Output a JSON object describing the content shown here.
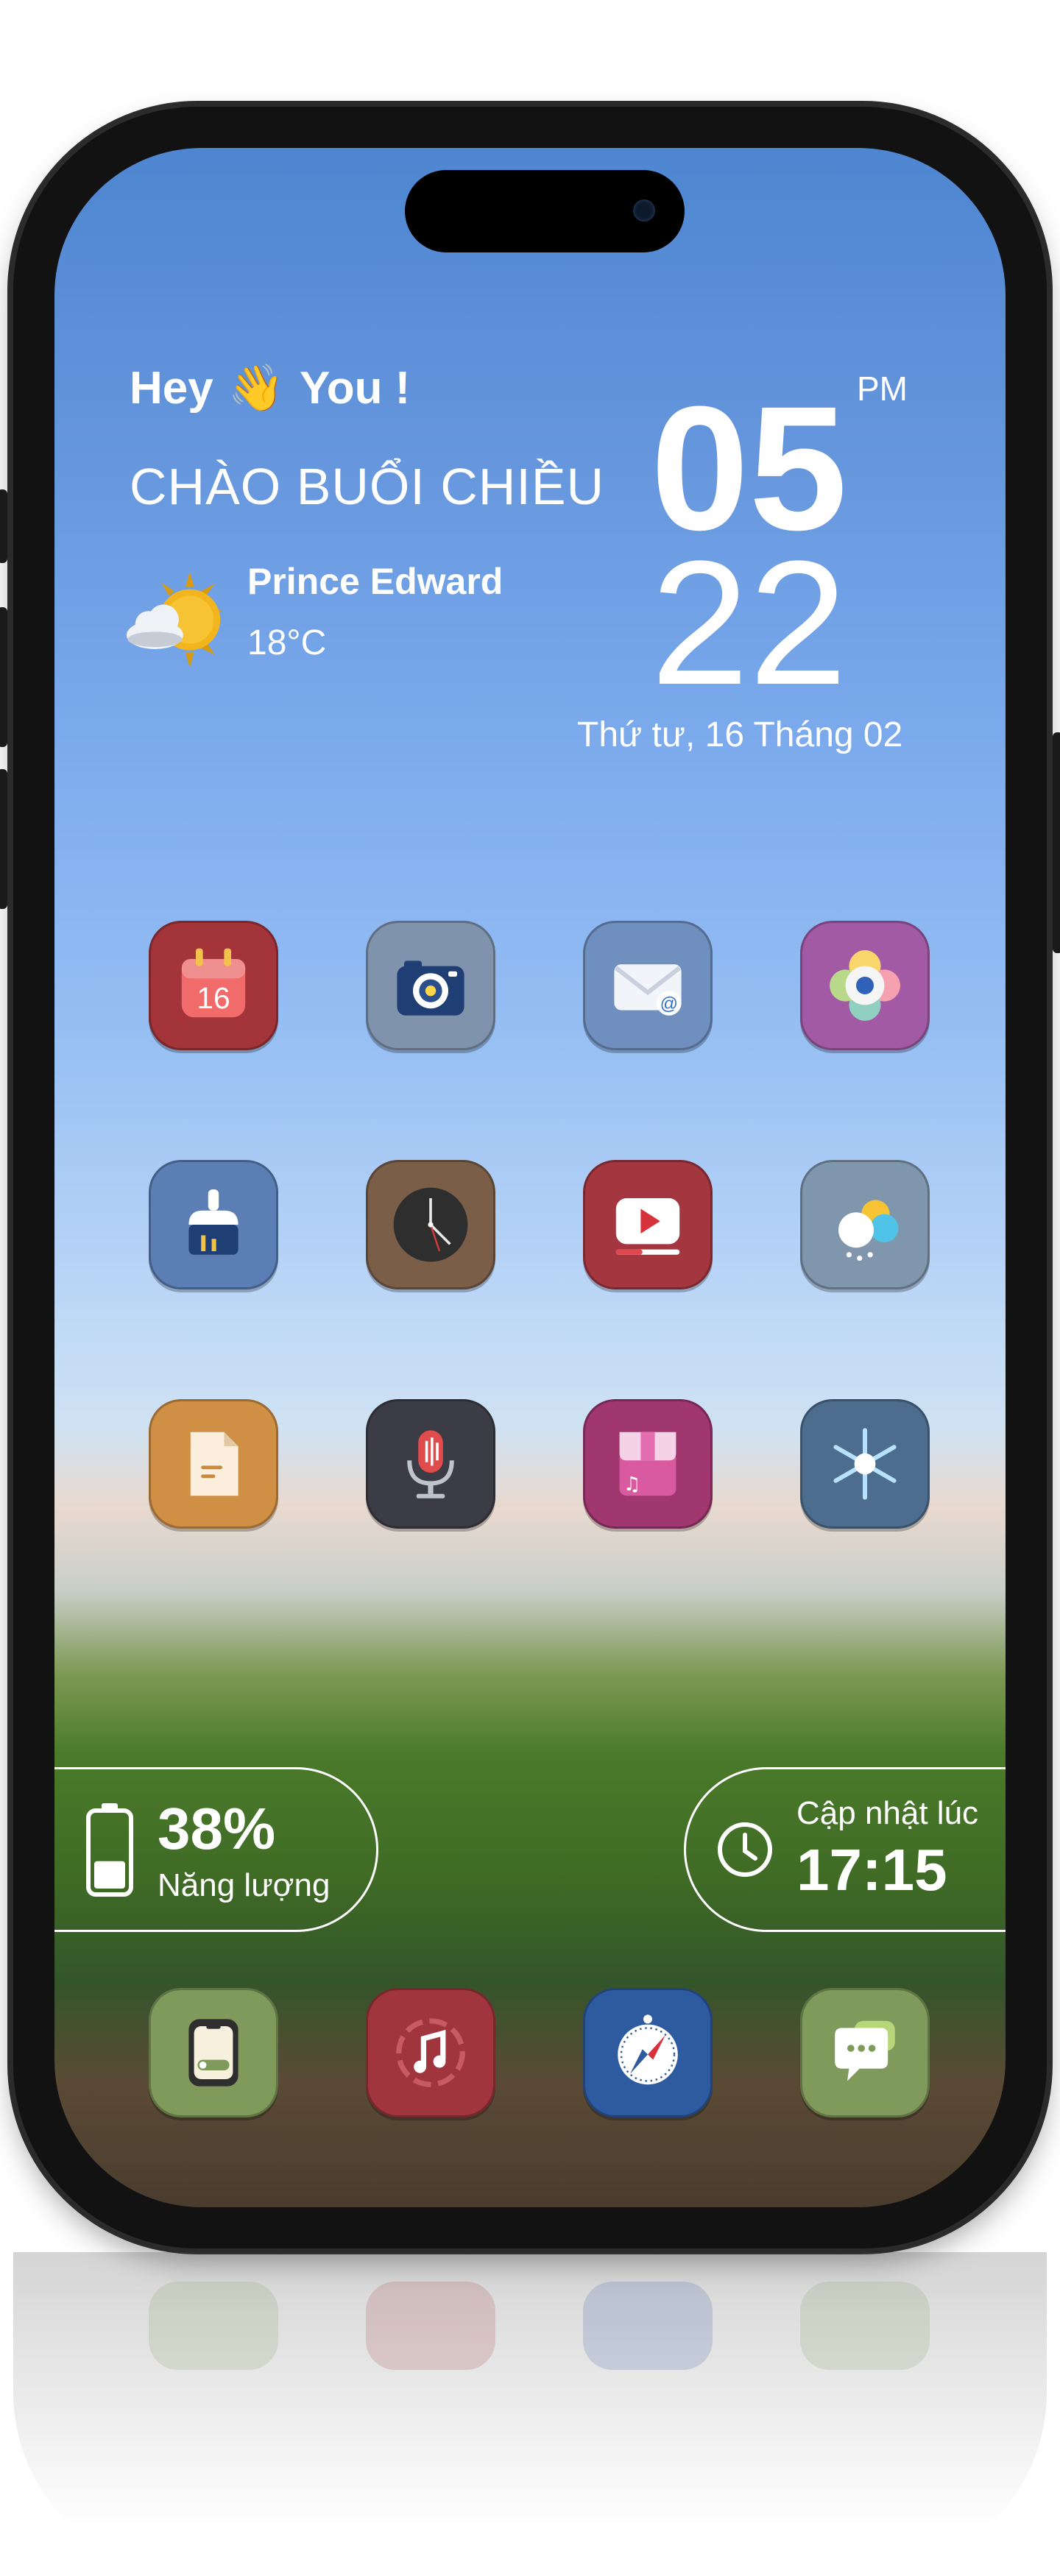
{
  "greeting": {
    "hey": "Hey",
    "hand": "👋",
    "you": "You !",
    "salutation": "CHÀO BUỔI CHIỀU"
  },
  "weather": {
    "icon": "partly-cloudy-sun-icon",
    "city": "Prince Edward",
    "temperature": "18°C"
  },
  "clock": {
    "hour": "05",
    "minute": "22",
    "ampm": "PM",
    "date": "Thứ tư, 16 Tháng 02"
  },
  "apps": [
    {
      "name": "calendar",
      "icon": "calendar-icon",
      "bg": "#a3353a",
      "label": "16"
    },
    {
      "name": "camera",
      "icon": "camera-icon",
      "bg": "#7f93ad"
    },
    {
      "name": "mail",
      "icon": "mail-icon",
      "bg": "#6f8fbe"
    },
    {
      "name": "photos",
      "icon": "flower-icon",
      "bg": "#a25aa5"
    },
    {
      "name": "cleaner",
      "icon": "brush-icon",
      "bg": "#5b7fb4"
    },
    {
      "name": "clock",
      "icon": "clock-icon",
      "bg": "#7a5e48"
    },
    {
      "name": "video",
      "icon": "video-play-icon",
      "bg": "#a3363f"
    },
    {
      "name": "weather",
      "icon": "weather-icon",
      "bg": "#7f96ad"
    },
    {
      "name": "notes",
      "icon": "note-icon",
      "bg": "#cf8f44"
    },
    {
      "name": "recorder",
      "icon": "microphone-icon",
      "bg": "#3c3c46"
    },
    {
      "name": "music-store",
      "icon": "store-icon",
      "bg": "#a1376f"
    },
    {
      "name": "freezer",
      "icon": "snowflake-icon",
      "bg": "#4d6d8e"
    }
  ],
  "battery": {
    "icon": "battery-icon",
    "value": "38%",
    "label": "Năng lượng",
    "level": 0.38
  },
  "update": {
    "icon": "clock-outline-icon",
    "label": "Cập nhật lúc",
    "time": "17:15"
  },
  "dock": [
    {
      "name": "phone",
      "icon": "phone-device-icon",
      "bg": "#7f9a5a"
    },
    {
      "name": "music",
      "icon": "music-icon",
      "bg": "#a0353d"
    },
    {
      "name": "safari",
      "icon": "compass-icon",
      "bg": "#2e5aa0"
    },
    {
      "name": "messages",
      "icon": "chat-icon",
      "bg": "#7f9a5a"
    }
  ]
}
